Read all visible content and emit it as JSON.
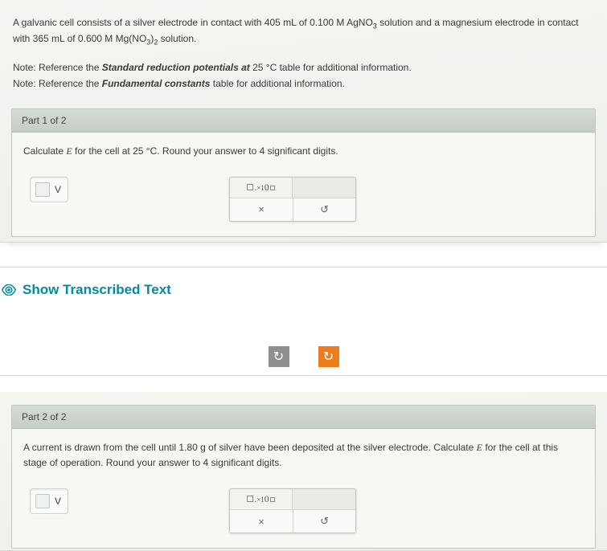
{
  "question": {
    "intro_a": "A galvanic cell consists of a silver electrode in contact with 405 mL of 0.100 M ",
    "compound_a": "AgNO",
    "compound_a_sub": "3",
    "intro_b": " solution and a magnesium electrode in contact with 365 mL of 0.600 M ",
    "compound_b_pre": "Mg(NO",
    "compound_b_sub1": "3",
    "compound_b_post": ")",
    "compound_b_sub2": "2",
    "intro_c": " solution."
  },
  "note1_a": "Note: Reference the ",
  "note1_b": "Standard reduction potentials at",
  "note1_c": " 25 °C table for additional information.",
  "note2_a": "Note: Reference the ",
  "note2_b": "Fundamental constants",
  "note2_c": " table for additional information.",
  "part1": {
    "header": "Part 1 of 2",
    "prompt_a": "Calculate ",
    "prompt_var": "E",
    "prompt_b": " for the cell at 25 °C. Round your answer to 4 significant digits.",
    "unit": "V",
    "btn_clear": "×",
    "btn_reset": "↺"
  },
  "show_transcribed": "Show Transcribed Text",
  "center": {
    "rotate_left": "↻",
    "rotate_right": "↻"
  },
  "part2": {
    "header": "Part 2 of 2",
    "prompt_a": "A current is drawn from the cell until 1.80 g of silver have been deposited at the silver electrode. Calculate ",
    "prompt_var": "E",
    "prompt_b": " for the cell at this stage of operation. Round your answer to 4 significant digits.",
    "unit": "V",
    "btn_clear": "×",
    "btn_reset": "↺"
  }
}
